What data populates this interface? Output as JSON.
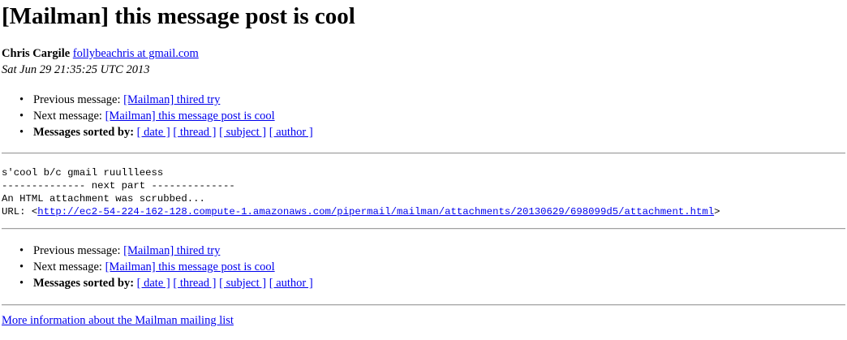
{
  "title": "[Mailman] this message post is cool",
  "author": {
    "name": "Chris Cargile",
    "email": "follybeachris at gmail.com "
  },
  "date": "Sat Jun 29 21:35:25 UTC 2013",
  "nav": {
    "bullet": "•",
    "previous_label": "Previous message:",
    "previous_link": "[Mailman] thired try",
    "next_label": "Next message:",
    "next_link": "[Mailman] this message post is cool",
    "sorted_label": "Messages sorted by:",
    "sort_links": [
      "[ date ]",
      "[ thread ]",
      "[ subject ]",
      "[ author ]"
    ]
  },
  "body": {
    "line1": "s'cool b/c gmail ruullleess",
    "line2": "-------------- next part --------------",
    "line3": "An HTML attachment was scrubbed...",
    "url_prefix": "URL: <",
    "url": "http://ec2-54-224-162-128.compute-1.amazonaws.com/pipermail/mailman/attachments/20130629/698099d5/attachment.html",
    "url_suffix": ">"
  },
  "footer": {
    "more_info_link": "More information about the Mailman mailing list"
  }
}
